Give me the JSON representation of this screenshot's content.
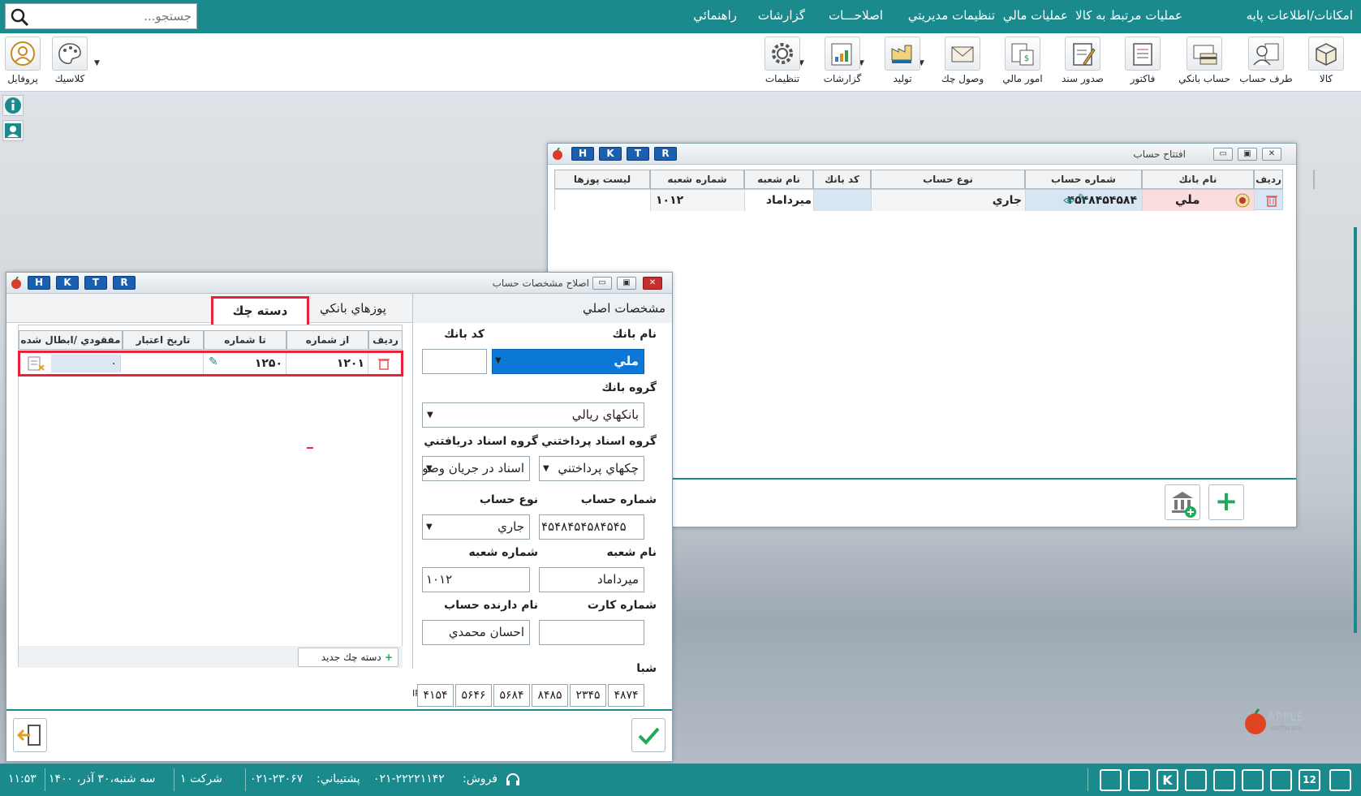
{
  "search": {
    "placeholder": "جستجو..."
  },
  "menu": [
    "امكانات/اطلاعات پايه",
    "عمليات مرتبط به كالا",
    "عمليات مالي",
    "تنظيمات مديريتي",
    "اصلاحـــات",
    "گزارشات",
    "راهنمائي"
  ],
  "toolbar": {
    "kala": "كالا",
    "taraf": "طرف حساب",
    "hesab_banki": "حساب بانكي",
    "factor": "فاكتور",
    "sanad": "صدور سند",
    "omur": "امور مالي",
    "check": "وصول چك",
    "tolid": "توليد",
    "gozareshat": "گزارشات",
    "tanzimat": "تنظيمات",
    "classic": "كلاسيك",
    "profile": "پروفايل"
  },
  "hktr": [
    "H",
    "K",
    "T",
    "R"
  ],
  "account_window": {
    "title": "افتتاح حساب",
    "columns": [
      "رديف",
      "نام بانك",
      "شماره حساب",
      "نوع حساب",
      "كد بانك",
      "نام شعبه",
      "شماره شعبه",
      "ليست پوزها"
    ],
    "row": {
      "bank": "ملي",
      "account_no": "۴۵۴۸۴۵۴۵۸۴",
      "type": "جاري",
      "bank_code": "",
      "branch_name": "ميرداماد",
      "branch_no": "۱۰۱۲",
      "pos": ""
    }
  },
  "edit_window": {
    "title": "اصلاح مشخصات حساب",
    "tabs": {
      "main": "مشخصات اصلي",
      "pos": "پوزهاي بانكي",
      "checkbook": "دسته چك"
    },
    "labels": {
      "bank_name": "نام بانك",
      "bank_code": "كد بانك",
      "bank_group": "گروه بانك",
      "pay_group": "گروه اسناد پرداختني",
      "recv_group": "گروه اسناد دريافتني",
      "account_no": "شماره حساب",
      "account_type": "نوع حساب",
      "branch_name": "نام شعبه",
      "branch_no": "شماره شعبه",
      "card_no": "شماره كارت",
      "owner": "نام دارنده حساب",
      "shiba": "شبا"
    },
    "values": {
      "bank_name": "ملي",
      "bank_code": "",
      "bank_group": "بانكهاي ريالي",
      "pay_group": "چكهاي پرداختني",
      "recv_group": "اسناد در جريان وصو",
      "account_no": "۴۵۴۸۴۵۴۵۸۴۵۴۵",
      "account_type": "جاري",
      "branch_name": "ميرداماد",
      "branch_no": "۱۰۱۲",
      "card_no": "",
      "owner": "احسان محمدي",
      "shiba_prefix": "IR",
      "shiba": [
        "۴۸۷۴",
        "۲۳۴۵",
        "۸۴۸۵",
        "۵۶۸۴",
        "۵۶۴۶",
        "۴۱۵۴"
      ]
    },
    "checkbook_columns": [
      "رديف",
      "از شماره",
      "تا شماره",
      "تاريخ اعتبار",
      "مفقودي /ابطال شده"
    ],
    "checkbook_row": {
      "from": "۱۲۰۱",
      "to": "۱۲۵۰",
      "expiry": "",
      "lost": "۰"
    },
    "new_checkbook": "دسته چك جديد"
  },
  "brand": {
    "name": "APPLE",
    "sub": "software"
  },
  "status": {
    "time": "۱۱:۵۳",
    "date": "سه شنبه،۳۰ آذر، ۱۴۰۰",
    "company": "شركت ۱",
    "sales_label": "فروش:",
    "sales": "۰۲۱-۲۲۲۲۱۱۴۲",
    "support_label": "پشتيباني:",
    "support": "۰۲۱-۲۳۰۶۷",
    "calendar_day": "12"
  },
  "colors": {
    "teal": "#1b8a8c",
    "selection": "#0b78d7",
    "highlight": "#e8243b"
  }
}
